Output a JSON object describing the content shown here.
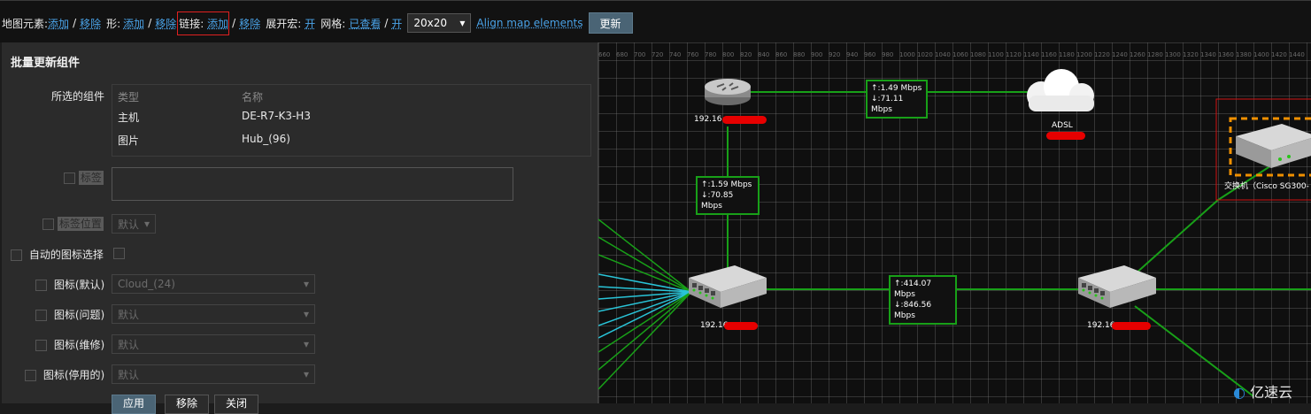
{
  "toolbar": {
    "map_elements_label": "地图元素:",
    "add": "添加",
    "slash": "/",
    "remove": "移除",
    "shapes_label": "形:",
    "links_label": "链接:",
    "expand_macros_label": "展开宏:",
    "expand_macros_value": "开",
    "grid_label": "网格:",
    "grid_shown": "已查看",
    "grid_on": "开",
    "grid_size": "20x20",
    "align_label": "Align map elements",
    "update_button": "更新"
  },
  "panel": {
    "title": "批量更新组件",
    "selected_label": "所选的组件",
    "col_type": "类型",
    "col_name": "名称",
    "rows": [
      {
        "type": "主机",
        "name": "DE-R7-K3-H3"
      },
      {
        "type": "图片",
        "name": "Hub_(96)"
      }
    ],
    "label_label": "标签",
    "label_location_label": "标签位置",
    "label_location_value": "默认",
    "auto_icon_label": "自动的图标选择",
    "icon_default_label": "图标(默认)",
    "icon_default_value": "Cloud_(24)",
    "icon_problem_label": "图标(问题)",
    "icon_problem_value": "默认",
    "icon_maintenance_label": "图标(维修)",
    "icon_maintenance_value": "默认",
    "icon_disabled_label": "图标(停用的)",
    "icon_disabled_value": "默认",
    "apply_button": "应用",
    "remove_button": "移除",
    "close_button": "关闭"
  },
  "map": {
    "ruler": [
      "660",
      "680",
      "700",
      "720",
      "740",
      "760",
      "780",
      "800",
      "820",
      "840",
      "860",
      "880",
      "900",
      "920",
      "940",
      "960",
      "980",
      "1000",
      "1020",
      "1040",
      "1060",
      "1080",
      "1100",
      "1120",
      "1140",
      "1160",
      "1180",
      "1200",
      "1220",
      "1240",
      "1260",
      "1280",
      "1300",
      "1320",
      "1340",
      "1360",
      "1380",
      "1400",
      "1420",
      "1440"
    ],
    "router_label": "192.16",
    "adsl_label": "ADSL",
    "switch_label": "交换机（Cisco SG300-",
    "hub1_label": "192.16",
    "hub2_label": "192.16",
    "link_top_up": "↑:1.49 Mbps",
    "link_top_down": "↓:71.11 Mbps",
    "link_left_up": "↑:1.59 Mbps",
    "link_left_down": "↓:70.85 Mbps",
    "link_mid_up": "↑:414.07 Mbps",
    "link_mid_down": "↓:846.56 Mbps",
    "link_color": "#18a018",
    "link_color_cyan": "#29c4d8"
  },
  "watermark": "亿速云"
}
